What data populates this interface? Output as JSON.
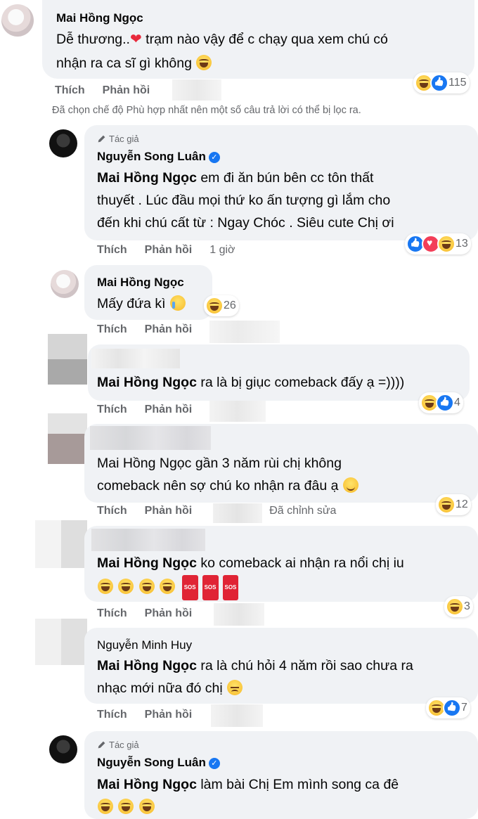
{
  "actions": {
    "like": "Thích",
    "reply": "Phản hồi"
  },
  "notice": "Đã chọn chế độ Phù hợp nhất nên một số câu trả lời có thể bị lọc ra.",
  "comments": [
    {
      "author": "Mai Hồng Ngọc",
      "lines": [
        "Dễ thương..",
        " trạm nào vậy để c chạy qua xem chú có",
        "nhận ra ca sĩ gì không"
      ],
      "reaction_count": "115",
      "reaction_types": [
        "haha",
        "like"
      ]
    },
    {
      "badge": "Tác giả",
      "author": "Nguyễn Song Luân",
      "verified": true,
      "mention": "Mai Hồng Ngọc",
      "lines": [
        " em đi ăn bún bên cc tôn thất",
        "thuyết . Lúc đầu mọi thứ ko ấn tượng gì lắm cho",
        "đến khi chú cất từ : Ngay Chóc . Siêu cute Chị ơi"
      ],
      "meta": "1 giờ",
      "reaction_count": "13",
      "reaction_types": [
        "like",
        "love",
        "haha"
      ]
    },
    {
      "author": "Mai Hồng Ngọc",
      "lines": [
        "Mấy đứa kì "
      ],
      "reaction_count": "26",
      "reaction_types": [
        "haha"
      ]
    },
    {
      "mention": "Mai Hồng Ngọc",
      "lines": [
        " ra là bị giục comeback đấy ạ =))))"
      ],
      "reaction_count": "4",
      "reaction_types": [
        "haha",
        "like"
      ]
    },
    {
      "lines": [
        "Mai Hồng Ngọc gần 3 năm rùi chị không",
        "comeback nên sợ chú ko nhận ra đâu ạ "
      ],
      "meta": "Đã chỉnh sửa",
      "reaction_count": "12",
      "reaction_types": [
        "haha"
      ]
    },
    {
      "mention": "Mai Hồng Ngọc",
      "lines": [
        " ko comeback ai nhận ra nổi chị iu"
      ],
      "sos": "SOS",
      "reaction_count": "3",
      "reaction_types": [
        "haha"
      ]
    },
    {
      "author": "Nguyễn Minh Huy",
      "mention": "Mai Hồng Ngọc",
      "lines": [
        " ra là chú hỏi 4 năm rồi sao chưa ra",
        "nhạc mới nữa đó chị "
      ],
      "reaction_count": "7",
      "reaction_types": [
        "haha",
        "like"
      ]
    },
    {
      "badge": "Tác giả",
      "author": "Nguyễn Song Luân",
      "verified": true,
      "mention": "Mai Hồng Ngọc",
      "lines": [
        " làm bài Chị Em mình song ca đê"
      ]
    }
  ]
}
